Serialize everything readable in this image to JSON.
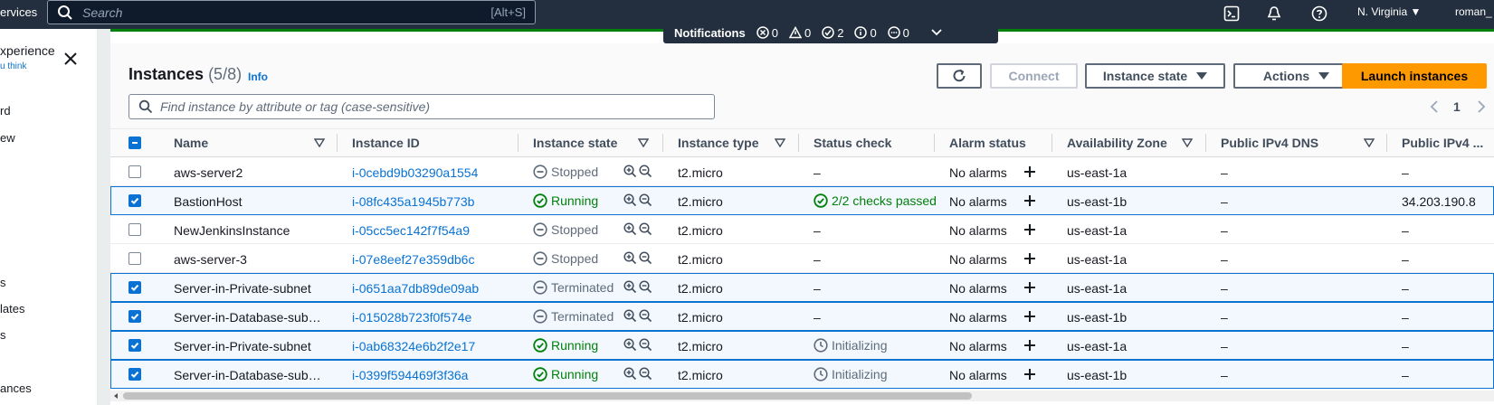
{
  "nav": {
    "services_label": "ervices",
    "search_placeholder": "Search",
    "search_shortcut": "[Alt+S]",
    "region": "N. Virginia",
    "user": "roman_"
  },
  "left_panel": {
    "banner_title": "xperience",
    "banner_link": "u think",
    "items": [
      "rd",
      "ew",
      "s",
      "lates",
      "s",
      "ances"
    ]
  },
  "notifications": {
    "label": "Notifications",
    "counts": [
      "0",
      "0",
      "2",
      "0",
      "0"
    ]
  },
  "header": {
    "title": "Instances",
    "count": "(5/8)",
    "info": "Info",
    "connect_label": "Connect",
    "instance_state_label": "Instance state",
    "actions_label": "Actions",
    "launch_label": "Launch instances",
    "filter_placeholder": "Find instance by attribute or tag (case-sensitive)",
    "page": "1"
  },
  "table": {
    "columns": [
      "Name",
      "Instance ID",
      "Instance state",
      "Instance type",
      "Status check",
      "Alarm status",
      "Availability Zone",
      "Public IPv4 DNS",
      "Public IPv4 ..."
    ],
    "rows": [
      {
        "selected": false,
        "name": "aws-server2",
        "id": "i-0cebd9b03290a1554",
        "state": "Stopped",
        "state_kind": "stopped",
        "type": "t2.micro",
        "status": "–",
        "status_kind": "none",
        "alarm": "No alarms",
        "az": "us-east-1a",
        "dns": "–",
        "ip": "–"
      },
      {
        "selected": true,
        "name": "BastionHost",
        "id": "i-08fc435a1945b773b",
        "state": "Running",
        "state_kind": "running",
        "type": "t2.micro",
        "status": "2/2 checks passed",
        "status_kind": "ok",
        "alarm": "No alarms",
        "az": "us-east-1b",
        "dns": "–",
        "ip": "34.203.190.8"
      },
      {
        "selected": false,
        "name": "NewJenkinsInstance",
        "id": "i-05cc5ec142f7f54a9",
        "state": "Stopped",
        "state_kind": "stopped",
        "type": "t2.micro",
        "status": "–",
        "status_kind": "none",
        "alarm": "No alarms",
        "az": "us-east-1a",
        "dns": "–",
        "ip": "–"
      },
      {
        "selected": false,
        "name": "aws-server-3",
        "id": "i-07e8eef27e359db6c",
        "state": "Stopped",
        "state_kind": "stopped",
        "type": "t2.micro",
        "status": "–",
        "status_kind": "none",
        "alarm": "No alarms",
        "az": "us-east-1a",
        "dns": "–",
        "ip": "–"
      },
      {
        "selected": true,
        "name": "Server-in-Private-subnet",
        "id": "i-0651aa7db89de09ab",
        "state": "Terminated",
        "state_kind": "terminated",
        "type": "t2.micro",
        "status": "–",
        "status_kind": "none",
        "alarm": "No alarms",
        "az": "us-east-1a",
        "dns": "–",
        "ip": "–"
      },
      {
        "selected": true,
        "name": "Server-in-Database-sub…",
        "id": "i-015028b723f0f574e",
        "state": "Terminated",
        "state_kind": "terminated",
        "type": "t2.micro",
        "status": "–",
        "status_kind": "none",
        "alarm": "No alarms",
        "az": "us-east-1b",
        "dns": "–",
        "ip": "–"
      },
      {
        "selected": true,
        "name": "Server-in-Private-subnet",
        "id": "i-0ab68324e6b2f2e17",
        "state": "Running",
        "state_kind": "running",
        "type": "t2.micro",
        "status": "Initializing",
        "status_kind": "init",
        "alarm": "No alarms",
        "az": "us-east-1a",
        "dns": "–",
        "ip": "–"
      },
      {
        "selected": true,
        "name": "Server-in-Database-sub…",
        "id": "i-0399f594469f3f36a",
        "state": "Running",
        "state_kind": "running",
        "type": "t2.micro",
        "status": "Initializing",
        "status_kind": "init",
        "alarm": "No alarms",
        "az": "us-east-1b",
        "dns": "–",
        "ip": "–"
      }
    ]
  },
  "colors": {
    "nav_bg": "#232f3e",
    "link": "#0972d3",
    "running": "#037f0c",
    "primary_button": "#ff9900"
  }
}
